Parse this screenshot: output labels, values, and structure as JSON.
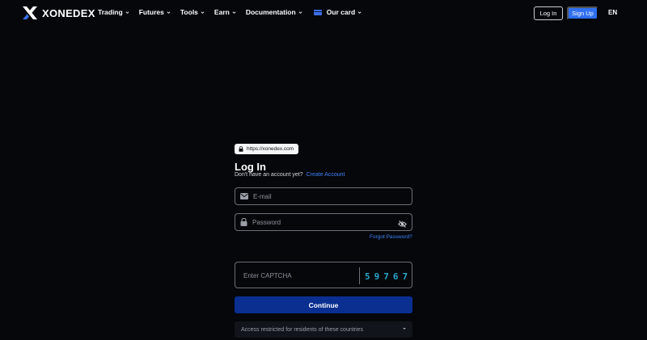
{
  "header": {
    "logo_text": "XONEDEX",
    "nav": [
      {
        "label": "Trading"
      },
      {
        "label": "Futures"
      },
      {
        "label": "Tools"
      },
      {
        "label": "Earn"
      },
      {
        "label": "Documentation"
      },
      {
        "label": "Our card"
      }
    ],
    "login_label": "Log In",
    "signup_label": "Sign Up",
    "language": "EN"
  },
  "form": {
    "url": "https://xonedex.com",
    "title": "Log In",
    "subtitle": "Don't have an account yet?",
    "create_account": "Create Account",
    "email_placeholder": "E-mail",
    "password_placeholder": "Password",
    "forgot": "Forgot Password?",
    "captcha_placeholder": "Enter CAPTCHA",
    "captcha_code": "59767",
    "continue_label": "Continue",
    "restricted": "Access restricted for residents of these countries"
  },
  "colors": {
    "background": "#05070b",
    "accent": "#2f6ff0",
    "continue": "#0a2f91",
    "link": "#3f83f8",
    "captcha": "#2aa6c9"
  }
}
